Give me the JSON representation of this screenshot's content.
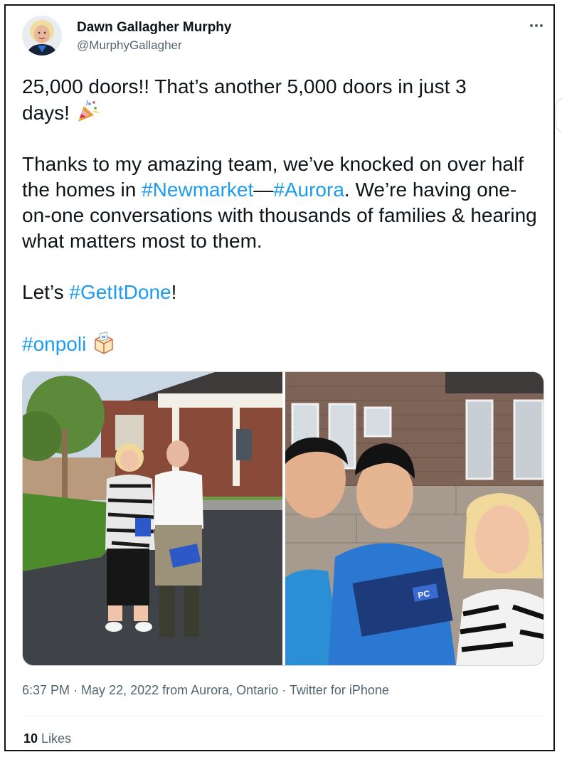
{
  "author": {
    "name": "Dawn Gallagher Murphy",
    "handle": "@MurphyGallagher"
  },
  "tweet": {
    "line1": "25,000 doors!! That’s another 5,000 doors in just 3",
    "line2": "days!",
    "para2_part1": "Thanks to my amazing team, we’ve knocked on over half the homes in ",
    "hashtag_newmarket": "#Newmarket",
    "dash": "—",
    "hashtag_aurora": "#Aurora",
    "para2_part2": ". We’re having one-on-one conversations with thousands of families & hearing what matters most to them.",
    "para3_part1": "Let’s ",
    "hashtag_getitdone": "#GetItDone",
    "para3_part2": "!",
    "hashtag_onpoli": "#onpoli"
  },
  "icons": {
    "more": "more-horizontal-icon",
    "party": "party-popper-emoji",
    "ballot": "ballot-box-emoji"
  },
  "media": {
    "left_sign_text": "",
    "right_sign_text": "PC"
  },
  "meta": {
    "time": "6:37 PM",
    "sep1": " · ",
    "date": "May 22, 2022",
    "from": " from ",
    "location": "Aurora, Ontario",
    "sep2": " · ",
    "client": "Twitter for iPhone"
  },
  "likes": {
    "count": "10",
    "label": " Likes"
  },
  "colors": {
    "link": "#1d9bf0",
    "text": "#0f1419",
    "secondary": "#536471"
  }
}
